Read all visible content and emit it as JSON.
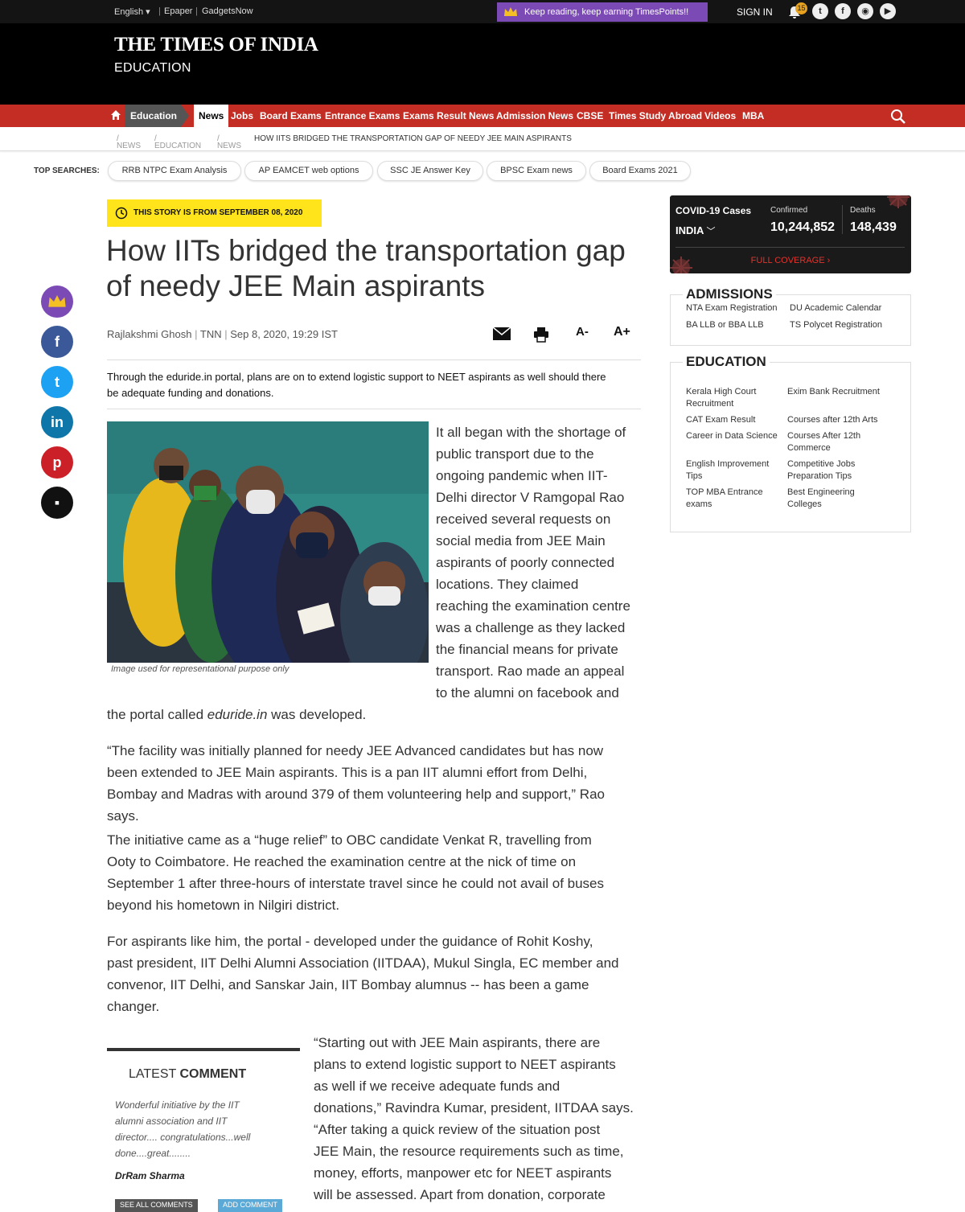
{
  "topbar": {
    "language": "English",
    "links": [
      "Epaper",
      "GadgetsNow"
    ],
    "promo": "Keep reading, keep earning TimesPoints!!",
    "signin": "SIGN IN",
    "notification_count": "15"
  },
  "masthead": {
    "logo": "THE TIMES OF INDIA",
    "section": "EDUCATION"
  },
  "nav": {
    "active_section": "Education",
    "active_item": "News",
    "items": [
      "Jobs",
      "Board Exams",
      "Entrance Exams",
      "Exams Result News",
      "Admission News",
      "CBSE",
      "Times Study Abroad",
      "Videos",
      "MBA"
    ]
  },
  "breadcrumb": {
    "items": [
      "NEWS",
      "EDUCATION",
      "NEWS"
    ],
    "current": "HOW IITS BRIDGED THE TRANSPORTATION GAP OF NEEDY JEE MAIN ASPIRANTS"
  },
  "top_searches": {
    "label": "TOP SEARCHES:",
    "items": [
      "RRB NTPC Exam Analysis",
      "AP EAMCET web options",
      "SSC JE Answer Key",
      "BPSC Exam news",
      "Board Exams 2021"
    ]
  },
  "article": {
    "story_date": "THIS STORY IS FROM SEPTEMBER 08, 2020",
    "headline": "How IITs bridged the transportation gap of needy JEE Main aspirants",
    "author": "Rajlakshmi Ghosh",
    "agency": "TNN",
    "datetime": "Sep 8, 2020, 19:29 IST",
    "font_decrease": "A-",
    "font_increase": "A+",
    "synopsis_line1": "Through the eduride.in portal, plans are on to extend logistic support to NEET aspirants as well should there",
    "synopsis_line2": "be adequate funding and donations.",
    "image_caption": "Image used for representational purpose only",
    "p1_lines": [
      "It all began with the shortage of",
      "public transport due to the",
      "ongoing pandemic when IIT-",
      "Delhi director V Ramgopal Rao",
      "received several requests on",
      "social media from JEE Main",
      "aspirants of poorly connected",
      "locations. They claimed",
      "reaching the examination centre",
      "was a challenge as they lacked",
      "the financial means for private",
      "transport. Rao made an appeal",
      "to the alumni on facebook and"
    ],
    "p1_tail_before": "the portal called ",
    "p1_tail_italic": "eduride.in",
    "p1_tail_after": " was developed.",
    "p2_lines": [
      "“The facility was initially planned for needy JEE Advanced candidates but has now",
      "been extended to JEE Main aspirants. This is a pan IIT alumni effort from Delhi,",
      "Bombay and Madras with around 379 of them volunteering help and support,” Rao",
      "says."
    ],
    "p3_lines": [
      "The initiative came as a “huge relief” to OBC candidate Venkat R, travelling from",
      "Ooty to Coimbatore. He reached the examination centre at the nick of time on",
      "September 1 after three-hours of interstate travel since he could not avail of buses",
      "beyond his hometown in Nilgiri district."
    ],
    "p4_lines": [
      "For aspirants like him, the portal - developed under the guidance of Rohit Koshy,",
      "past president, IIT Delhi Alumni Association (IITDAA), Mukul Singla, EC member and",
      "convenor, IIT Delhi, and Sanskar Jain, IIT Bombay alumnus -- has been a game",
      "changer."
    ],
    "p5_lines": [
      "“Starting out with JEE Main aspirants, there are",
      "plans to extend logistic support to NEET aspirants",
      "as well if we receive adequate funds and",
      "donations,” Ravindra Kumar, president, IITDAA says.",
      "“After taking a quick review of the situation post",
      "JEE Main, the resource requirements such as time,",
      "money, efforts, manpower etc for NEET aspirants",
      "will be assessed. Apart from donation, corporate"
    ]
  },
  "latest_comment": {
    "title_a": "LATEST ",
    "title_b": "COMMENT",
    "text_lines": [
      "Wonderful initiative by the IIT",
      "alumni association and IIT",
      "director.... congratulations...well",
      "done....great........"
    ],
    "author": "DrRam Sharma",
    "see_all": "SEE ALL COMMENTS",
    "add": "ADD COMMENT"
  },
  "covid": {
    "title": "COVID-19 Cases",
    "country": "INDIA",
    "confirmed_label": "Confirmed",
    "confirmed": "10,244,852",
    "deaths_label": "Deaths",
    "deaths": "148,439",
    "full_coverage": "FULL COVERAGE"
  },
  "admissions": {
    "title": "ADMISSIONS",
    "links": [
      "NTA Exam Registration",
      "DU Academic Calendar",
      "BA LLB or BBA LLB",
      "TS Polycet Registration"
    ]
  },
  "education": {
    "title": "EDUCATION",
    "links": [
      [
        "Kerala High Court",
        "Recruitment"
      ],
      [
        "Exim Bank Recruitment"
      ],
      [
        "CAT Exam Result"
      ],
      [
        "Courses after 12th Arts"
      ],
      [
        "Career in Data Science"
      ],
      [
        "Courses After 12th",
        "Commerce"
      ],
      [
        "English Improvement",
        "Tips"
      ],
      [
        "Competitive Jobs",
        "Preparation Tips"
      ],
      [
        "TOP MBA Entrance",
        "exams"
      ],
      [
        "Best Engineering",
        "Colleges"
      ]
    ]
  },
  "colors": {
    "nav_red": "#c32d24",
    "promo_purple": "#7b4ab5",
    "story_yellow": "#ffe41c",
    "facebook": "#3b5998",
    "twitter": "#1da1f2",
    "linkedin": "#0e76a8",
    "pinterest": "#cb2027"
  }
}
